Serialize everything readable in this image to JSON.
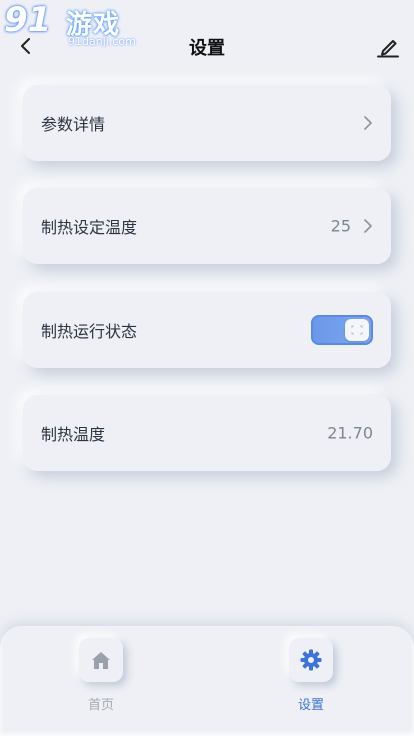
{
  "watermark": {
    "number": "91",
    "brand": "游戏",
    "site": "91danji.com"
  },
  "header": {
    "title": "设置"
  },
  "cards": [
    {
      "label": "参数详情"
    },
    {
      "label": "制热设定温度",
      "value": "25"
    },
    {
      "label": "制热运行状态",
      "toggle_on": true
    },
    {
      "label": "制热温度",
      "value": "21.70"
    }
  ],
  "nav": {
    "items": [
      {
        "label": "首页",
        "icon": "home-icon",
        "active": false
      },
      {
        "label": "设置",
        "icon": "gear-icon",
        "active": true
      }
    ]
  },
  "colors": {
    "background": "#eef0f5",
    "accent": "#3f73d8",
    "toggle": "#6a97e8"
  }
}
